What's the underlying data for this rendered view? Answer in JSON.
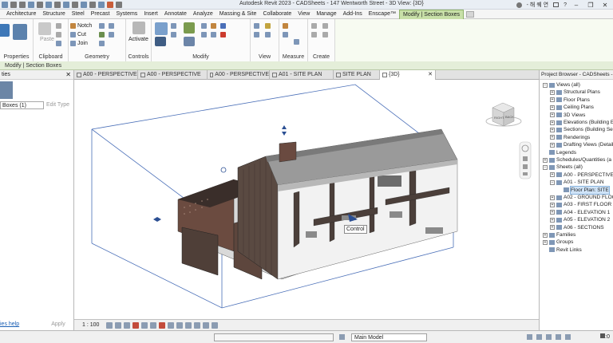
{
  "window": {
    "title": "Autodesk Revit 2023 - CADSheets - 147 Wentworth Street - 3D View: {3D}",
    "user": "- 해 퀘 연"
  },
  "ribbon_tabs": [
    {
      "label": "Architecture",
      "active": false
    },
    {
      "label": "Structure",
      "active": false
    },
    {
      "label": "Steel",
      "active": false
    },
    {
      "label": "Precast",
      "active": false
    },
    {
      "label": "Systems",
      "active": false
    },
    {
      "label": "Insert",
      "active": false
    },
    {
      "label": "Annotate",
      "active": false
    },
    {
      "label": "Analyze",
      "active": false
    },
    {
      "label": "Massing & Site",
      "active": false
    },
    {
      "label": "Collaborate",
      "active": false
    },
    {
      "label": "View",
      "active": false
    },
    {
      "label": "Manage",
      "active": false
    },
    {
      "label": "Add-Ins",
      "active": false
    },
    {
      "label": "Enscape™",
      "active": false
    },
    {
      "label": "Modify | Section Boxes",
      "active": true
    }
  ],
  "ribbon": {
    "properties_label": "Properties",
    "clipboard_label": "Clipboard",
    "paste_label": "Paste",
    "geometry_label": "Geometry",
    "notch_label": "Notch",
    "cut_label": "Cut",
    "join_label": "Join",
    "controls_label": "Controls",
    "activate_label": "Activate",
    "modify_label": "Modify",
    "view_label": "View",
    "measure_label": "Measure",
    "create_label": "Create"
  },
  "context_strip": "Modify | Section Boxes",
  "properties_panel": {
    "header": "ties",
    "type_select": "Boxes (1)",
    "edit_type": "Edit Type",
    "help_link": "ies help",
    "apply": "Apply"
  },
  "view_tabs": [
    {
      "label": "A00 - PERSPECTIVE",
      "active": false
    },
    {
      "label": "A00 - PERSPECTIVE",
      "active": false
    },
    {
      "label": "A00 - PERSPECTIVE",
      "active": false
    },
    {
      "label": "A01 - SITE PLAN",
      "active": false
    },
    {
      "label": "SITE PLAN",
      "active": false
    },
    {
      "label": "{3D}",
      "active": true
    }
  ],
  "viewport": {
    "control_tooltip": "Control",
    "viewcube_labels": [
      "RIGHT",
      "BACK"
    ]
  },
  "view_control_bar": {
    "scale": "1 : 100"
  },
  "project_browser": {
    "header": "Project Browser - CADSheets - 14",
    "rows": [
      {
        "label": "Views (all)",
        "level": 0,
        "expander": "−"
      },
      {
        "label": "Structural Plans",
        "level": 1,
        "expander": "+"
      },
      {
        "label": "Floor Plans",
        "level": 1,
        "expander": "+"
      },
      {
        "label": "Ceiling Plans",
        "level": 1,
        "expander": "+"
      },
      {
        "label": "3D Views",
        "level": 1,
        "expander": "+"
      },
      {
        "label": "Elevations (Building El",
        "level": 1,
        "expander": "+"
      },
      {
        "label": "Sections (Building Sec",
        "level": 1,
        "expander": "+"
      },
      {
        "label": "Renderings",
        "level": 1,
        "expander": "+"
      },
      {
        "label": "Drafting Views (Detail)",
        "level": 1,
        "expander": "+"
      },
      {
        "label": "Legends",
        "level": 0,
        "expander": ""
      },
      {
        "label": "Schedules/Quantities (a",
        "level": 0,
        "expander": "+"
      },
      {
        "label": "Sheets (all)",
        "level": 0,
        "expander": "−"
      },
      {
        "label": "A00 - PERSPECTIVE",
        "level": 1,
        "expander": "+"
      },
      {
        "label": "A01 - SITE PLAN",
        "level": 1,
        "expander": "−"
      },
      {
        "label": "Floor Plan: SITE",
        "level": 2,
        "expander": "",
        "selected": true
      },
      {
        "label": "A02 - GROUND FLOOR",
        "level": 1,
        "expander": "+"
      },
      {
        "label": "A03 - FIRST FLOOR",
        "level": 1,
        "expander": "+"
      },
      {
        "label": "A04 - ELEVATION 1",
        "level": 1,
        "expander": "+"
      },
      {
        "label": "A05 - ELEVATION 2",
        "level": 1,
        "expander": "+"
      },
      {
        "label": "A06 - SECTIONS",
        "level": 1,
        "expander": "+"
      },
      {
        "label": "Families",
        "level": 0,
        "expander": "+"
      },
      {
        "label": "Groups",
        "level": 0,
        "expander": "+"
      },
      {
        "label": "Revit Links",
        "level": 0,
        "expander": ""
      }
    ]
  },
  "status_bar": {
    "model": "Main Model",
    "filter_count": ":0"
  },
  "colors": {
    "active_tab": "#c8e0a8",
    "section_box": "#4a6fb8",
    "roof": "#8e8e8e",
    "cladding": "#5a4a42",
    "interior_floor": "#f2f2f2"
  }
}
